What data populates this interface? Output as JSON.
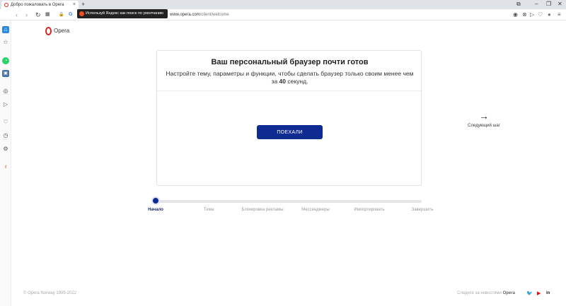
{
  "tab": {
    "title": "Добро пожаловать в Opera",
    "close": "×",
    "new_tab": "+"
  },
  "window_controls": {
    "snap": "⧉",
    "minimize": "–",
    "maximize": "❐",
    "close": "✕"
  },
  "address_bar": {
    "tooltip": "Используй Яндекс как поиск по умолчанию",
    "url_host": "www.opera.com",
    "url_path": "/client/welcome"
  },
  "icons": {
    "back": "‹",
    "forward": "›",
    "reload": "↻",
    "tabs": "▦",
    "lock": "🔒",
    "search_engine": "G",
    "camera": "◉",
    "shield": "⊗",
    "send": "▷",
    "heart": "♡",
    "menu": "≡",
    "user": "●",
    "sidebar_home": "⌂",
    "sidebar_star": "☆",
    "sidebar_whatsapp": "◔",
    "sidebar_vk": "▣",
    "sidebar_messenger": "◎",
    "sidebar_send": "▷",
    "sidebar_heart": "♡",
    "sidebar_history": "◷",
    "sidebar_settings": "⚙",
    "sidebar_tips": "♁",
    "next_arrow": "→",
    "twitter": "🐦",
    "youtube": "▶",
    "linkedin": "in"
  },
  "brand": {
    "name": "Opera",
    "color": "#d9241c"
  },
  "card": {
    "title": "Ваш персональный браузер почти готов",
    "subtitle_before": "Настройте тему, параметры и функции, чтобы сделать браузер только своим менее чем за ",
    "subtitle_number": "40",
    "subtitle_after": " секунд.",
    "button": "ПОЕХАЛИ",
    "button_color": "#0d2b91"
  },
  "next_step": {
    "label": "Следующий шаг"
  },
  "progress": {
    "current_step": 0,
    "steps": [
      {
        "label": "Начало"
      },
      {
        "label": "Тема"
      },
      {
        "label": "Блокировка рекламы"
      },
      {
        "label": "Мессенджеры"
      },
      {
        "label": "Импортировать"
      },
      {
        "label": "Завершить"
      }
    ]
  },
  "footer": {
    "copyright": "© Opera Norway 1995-2022",
    "follow_prefix": "Следите за новостями ",
    "follow_brand": "Opera"
  }
}
